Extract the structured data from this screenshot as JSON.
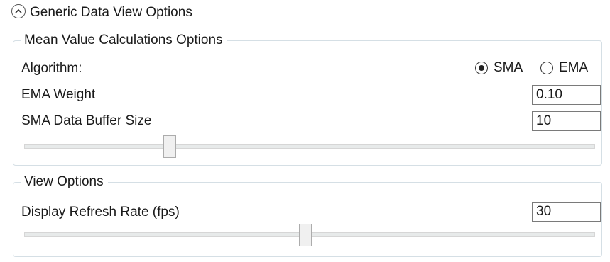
{
  "expander": {
    "title": "Generic Data View Options",
    "toggle_icon": "chevron-up-icon",
    "expanded": true
  },
  "mean_value_group": {
    "title": "Mean Value Calculations Options",
    "algorithm_label": "Algorithm:",
    "algorithm_options": [
      {
        "label": "SMA",
        "selected": true
      },
      {
        "label": "EMA",
        "selected": false
      }
    ],
    "ema_weight_label": "EMA Weight",
    "ema_weight_value": "0.10",
    "sma_buffer_label": "SMA Data Buffer Size",
    "sma_buffer_value": "10",
    "sma_buffer_slider_fraction": 0.25
  },
  "view_group": {
    "title": "View Options",
    "refresh_label": "Display Refresh Rate (fps)",
    "refresh_value": "30",
    "refresh_slider_fraction": 0.5
  }
}
